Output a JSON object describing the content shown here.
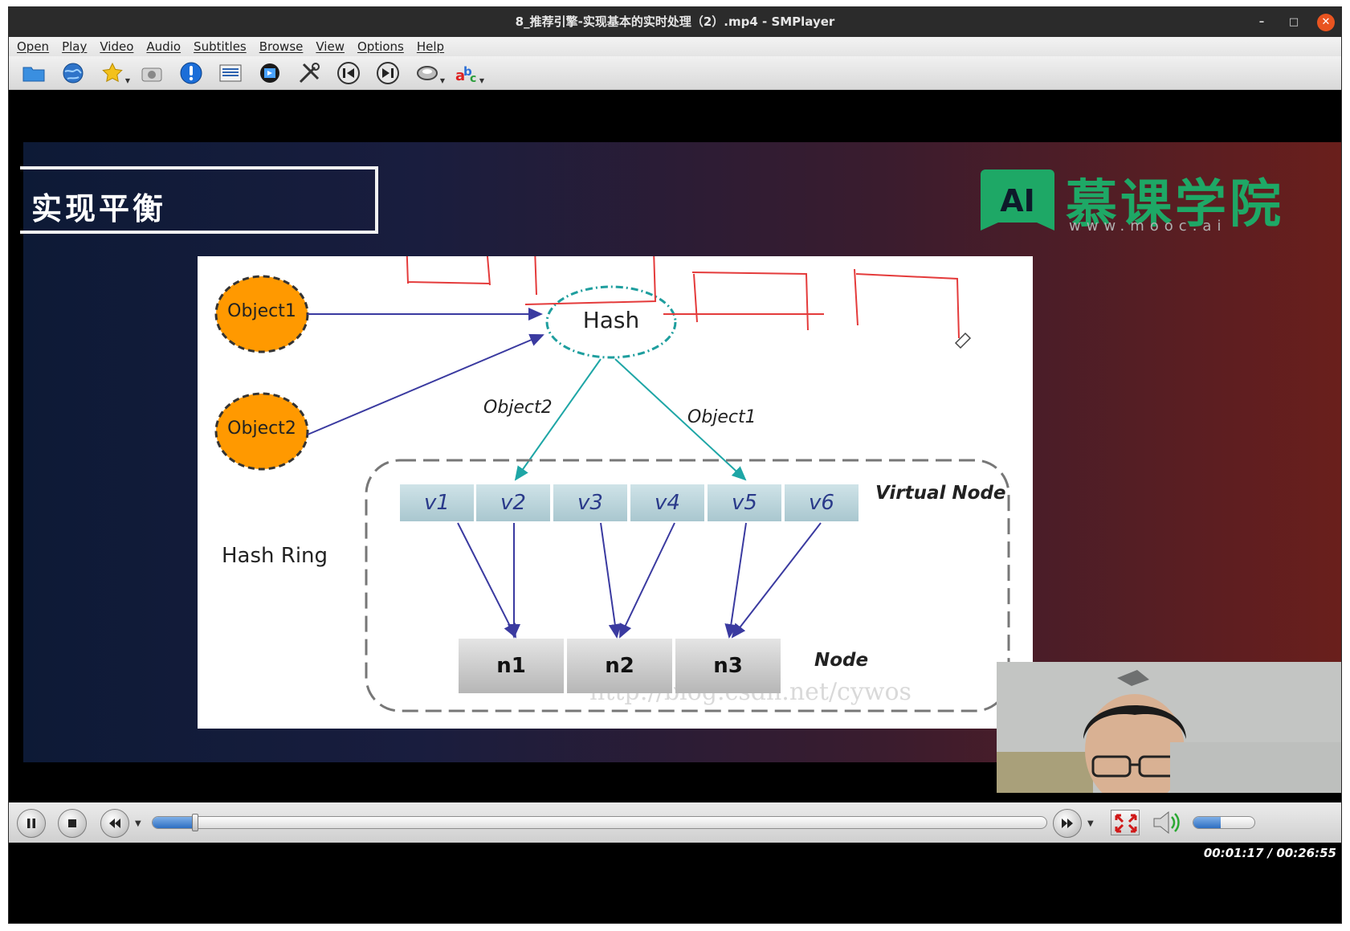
{
  "window": {
    "title": "8_推荐引擎-实现基本的实时处理（2）.mp4 - SMPlayer"
  },
  "menu": [
    "Open",
    "Play",
    "Video",
    "Audio",
    "Subtitles",
    "Browse",
    "View",
    "Options",
    "Help"
  ],
  "toolbar_icons": [
    "folder-icon",
    "globe-icon",
    "star-icon",
    "camera-icon",
    "info-icon",
    "playlist-icon",
    "film-icon",
    "tools-icon",
    "previous-icon",
    "next-icon",
    "audio-icon",
    "spellcheck-icon"
  ],
  "slide": {
    "title": "实现平衡",
    "logo_text": "慕课学院",
    "logo_mark_text": "AI",
    "logo_url": "www.mooc.ai"
  },
  "diagram": {
    "object1": "Object1",
    "object2": "Object2",
    "hash": "Hash",
    "edge_object2": "Object2",
    "edge_object1": "Object1",
    "virtual_nodes": [
      "v1",
      "v2",
      "v3",
      "v4",
      "v5",
      "v6"
    ],
    "virtual_label": "Virtual Node",
    "nodes": [
      "n1",
      "n2",
      "n3"
    ],
    "node_label": "Node",
    "ring_label": "Hash Ring",
    "watermark": "http://blog.csdn.net/cywos"
  },
  "playback": {
    "current": "00:01:17",
    "total": "00:26:55",
    "time_display": "00:01:17 / 00:26:55",
    "progress_fraction": 0.048,
    "volume_fraction": 0.45
  },
  "colors": {
    "accent": "#2e6fc2",
    "logo_green": "#1ea866",
    "object_orange": "#ff9900",
    "hash_teal": "#1e9e9e"
  }
}
